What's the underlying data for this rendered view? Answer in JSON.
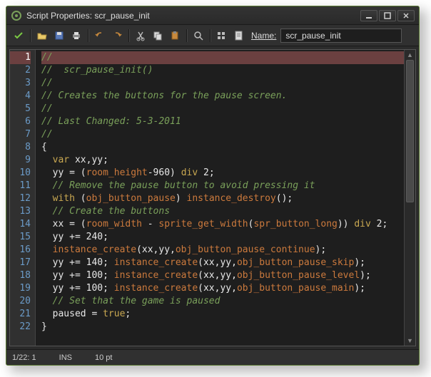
{
  "window": {
    "title": "Script Properties: scr_pause_init"
  },
  "toolbar": {
    "name_label": "Name:",
    "name_value": "scr_pause_init"
  },
  "code": {
    "lines": [
      {
        "n": 1,
        "tokens": [
          {
            "t": "//",
            "c": "com"
          }
        ]
      },
      {
        "n": 2,
        "tokens": [
          {
            "t": "//  scr_pause_init()",
            "c": "com"
          }
        ]
      },
      {
        "n": 3,
        "tokens": [
          {
            "t": "//",
            "c": "com"
          }
        ]
      },
      {
        "n": 4,
        "tokens": [
          {
            "t": "// Creates the buttons for the pause screen.",
            "c": "com"
          }
        ]
      },
      {
        "n": 5,
        "tokens": [
          {
            "t": "//",
            "c": "com"
          }
        ]
      },
      {
        "n": 6,
        "tokens": [
          {
            "t": "// Last Changed: 5-3-2011",
            "c": "com"
          }
        ]
      },
      {
        "n": 7,
        "tokens": [
          {
            "t": "//",
            "c": "com"
          }
        ]
      },
      {
        "n": 8,
        "tokens": [
          {
            "t": "{",
            "c": "punc"
          }
        ]
      },
      {
        "n": 9,
        "tokens": [
          {
            "t": "  ",
            "c": "punc"
          },
          {
            "t": "var",
            "c": "kw"
          },
          {
            "t": " xx,yy;",
            "c": "punc"
          }
        ]
      },
      {
        "n": 10,
        "tokens": [
          {
            "t": "  yy = (",
            "c": "punc"
          },
          {
            "t": "room_height",
            "c": "id"
          },
          {
            "t": "-960) ",
            "c": "punc"
          },
          {
            "t": "div",
            "c": "kw"
          },
          {
            "t": " 2;",
            "c": "punc"
          }
        ]
      },
      {
        "n": 11,
        "tokens": [
          {
            "t": "  ",
            "c": "punc"
          },
          {
            "t": "// Remove the pause button to avoid pressing it",
            "c": "com"
          }
        ]
      },
      {
        "n": 12,
        "tokens": [
          {
            "t": "  ",
            "c": "punc"
          },
          {
            "t": "with",
            "c": "kw"
          },
          {
            "t": " (",
            "c": "punc"
          },
          {
            "t": "obj_button_pause",
            "c": "id"
          },
          {
            "t": ") ",
            "c": "punc"
          },
          {
            "t": "instance_destroy",
            "c": "fn"
          },
          {
            "t": "();",
            "c": "punc"
          }
        ]
      },
      {
        "n": 13,
        "tokens": [
          {
            "t": "  ",
            "c": "punc"
          },
          {
            "t": "// Create the buttons",
            "c": "com"
          }
        ]
      },
      {
        "n": 14,
        "tokens": [
          {
            "t": "  xx = (",
            "c": "punc"
          },
          {
            "t": "room_width",
            "c": "id"
          },
          {
            "t": " - ",
            "c": "punc"
          },
          {
            "t": "sprite_get_width",
            "c": "fn"
          },
          {
            "t": "(",
            "c": "punc"
          },
          {
            "t": "spr_button_long",
            "c": "id"
          },
          {
            "t": ")) ",
            "c": "punc"
          },
          {
            "t": "div",
            "c": "kw"
          },
          {
            "t": " 2;",
            "c": "punc"
          }
        ]
      },
      {
        "n": 15,
        "tokens": [
          {
            "t": "  yy += 240;",
            "c": "punc"
          }
        ]
      },
      {
        "n": 16,
        "tokens": [
          {
            "t": "  ",
            "c": "punc"
          },
          {
            "t": "instance_create",
            "c": "fn"
          },
          {
            "t": "(xx,yy,",
            "c": "punc"
          },
          {
            "t": "obj_button_pause_continue",
            "c": "id"
          },
          {
            "t": ");",
            "c": "punc"
          }
        ]
      },
      {
        "n": 17,
        "tokens": [
          {
            "t": "  yy += 140; ",
            "c": "punc"
          },
          {
            "t": "instance_create",
            "c": "fn"
          },
          {
            "t": "(xx,yy,",
            "c": "punc"
          },
          {
            "t": "obj_button_pause_skip",
            "c": "id"
          },
          {
            "t": ");",
            "c": "punc"
          }
        ]
      },
      {
        "n": 18,
        "tokens": [
          {
            "t": "  yy += 100; ",
            "c": "punc"
          },
          {
            "t": "instance_create",
            "c": "fn"
          },
          {
            "t": "(xx,yy,",
            "c": "punc"
          },
          {
            "t": "obj_button_pause_level",
            "c": "id"
          },
          {
            "t": ");",
            "c": "punc"
          }
        ]
      },
      {
        "n": 19,
        "tokens": [
          {
            "t": "  yy += 100; ",
            "c": "punc"
          },
          {
            "t": "instance_create",
            "c": "fn"
          },
          {
            "t": "(xx,yy,",
            "c": "punc"
          },
          {
            "t": "obj_button_pause_main",
            "c": "id"
          },
          {
            "t": ");",
            "c": "punc"
          }
        ]
      },
      {
        "n": 20,
        "tokens": [
          {
            "t": "  ",
            "c": "punc"
          },
          {
            "t": "// Set that the game is paused",
            "c": "com"
          }
        ]
      },
      {
        "n": 21,
        "tokens": [
          {
            "t": "  paused = ",
            "c": "punc"
          },
          {
            "t": "true",
            "c": "kw"
          },
          {
            "t": ";",
            "c": "punc"
          }
        ]
      },
      {
        "n": 22,
        "tokens": [
          {
            "t": "}",
            "c": "punc"
          }
        ]
      }
    ]
  },
  "status": {
    "pos": "1/22: 1",
    "mode": "INS",
    "font": "10 pt"
  },
  "colors": {
    "comment": "#7aa05a",
    "keyword": "#c9a851",
    "func": "#cc7a3d",
    "ident": "#cc7a3d",
    "bg": "#1e1e1e"
  }
}
